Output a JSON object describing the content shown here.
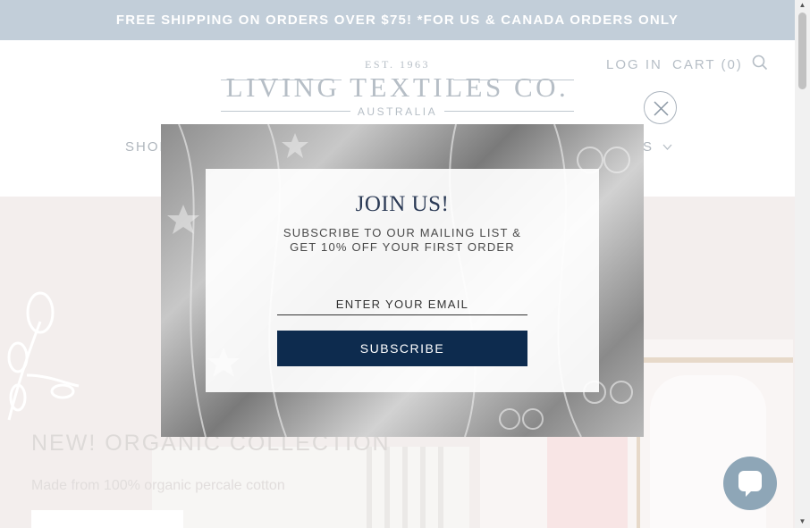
{
  "announcement": {
    "text": "FREE SHIPPING ON ORDERS OVER $75! *FOR US & CANADA ORDERS ONLY"
  },
  "header": {
    "logo": {
      "est": "EST. 1963",
      "name": "LIVING TEXTILES CO.",
      "sub": "AUSTRALIA"
    },
    "login_label": "LOG IN",
    "cart_label": "CART (0)",
    "search_icon": "search-icon"
  },
  "nav": {
    "items": [
      {
        "label": "SHOP"
      },
      {
        "label": "S"
      }
    ]
  },
  "hero": {
    "title": "NEW! ORGANIC COLLECTION",
    "subtitle": "Made from 100% organic percale cotton"
  },
  "modal": {
    "title": "JOIN US!",
    "line1": "SUBSCRIBE TO OUR MAILING LIST &",
    "line2": "GET 10% OFF YOUR FIRST ORDER",
    "email_placeholder": "ENTER YOUR EMAIL",
    "button_label": "SUBSCRIBE",
    "close_icon": "close-icon"
  },
  "chat": {
    "icon": "chat-icon"
  },
  "colors": {
    "announcement_bg": "#9db0c2",
    "button_bg": "#0d2b4e",
    "title": "#2b3a55",
    "chat_bg": "#8ea6b7"
  }
}
